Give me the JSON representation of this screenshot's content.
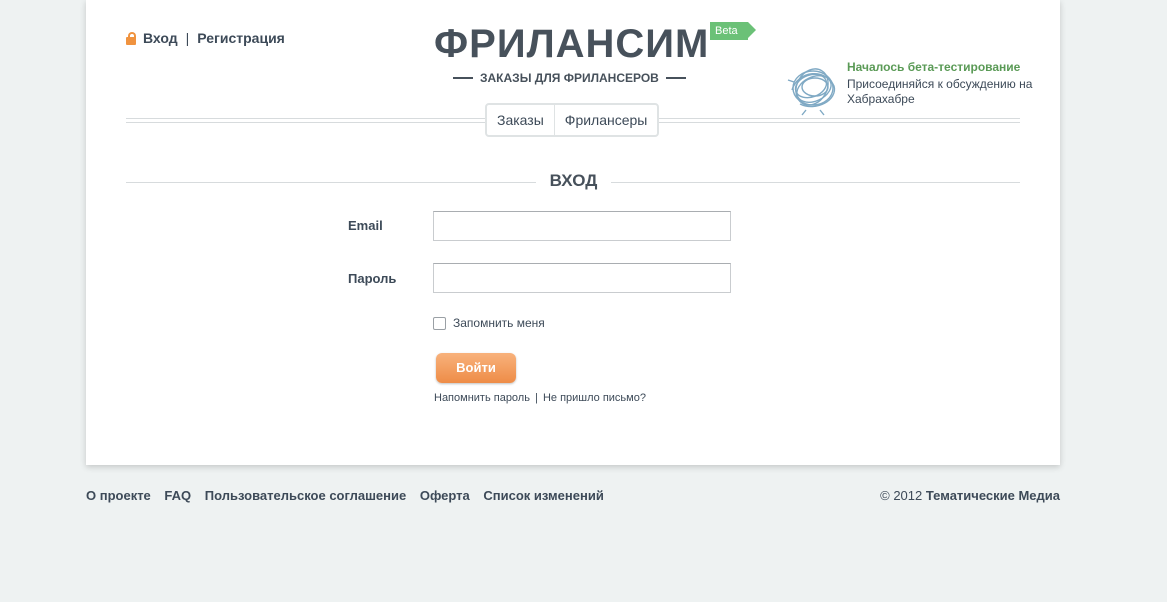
{
  "header": {
    "login_label": "Вход",
    "separator": "|",
    "register_label": "Регистрация",
    "logo_title": "ФРИЛАНСИМ",
    "beta_badge": "Beta",
    "tagline": "ЗАКАЗЫ ДЛЯ ФРИЛАНСЕРОВ",
    "promo_title": "Началось бета-тестирование",
    "promo_text": "Присоединяйся к обсуждению на Хабрахабре"
  },
  "tabs": [
    {
      "label": "Заказы"
    },
    {
      "label": "Фрилансеры"
    }
  ],
  "form": {
    "heading": "ВХОД",
    "email_label": "Email",
    "email_value": "",
    "password_label": "Пароль",
    "password_value": "",
    "remember_label": "Запомнить меня",
    "remember_checked": false,
    "submit_label": "Войти",
    "forgot_link": "Напомнить пароль",
    "links_sep": "|",
    "no_email_link": "Не пришло письмо?"
  },
  "footer": {
    "links": [
      "О проекте",
      "FAQ",
      "Пользовательское соглашение",
      "Оферта",
      "Список изменений"
    ],
    "copyright_prefix": "© 2012",
    "copyright_owner": "Тематические Медиа"
  },
  "colors": {
    "background": "#eef2f2",
    "accent_orange": "#ee8c47",
    "beta_green": "#6bc177",
    "promo_green": "#5a9a56",
    "text_dark": "#3d4a58"
  },
  "icons": {
    "lock": "lock-icon",
    "promo": "habr-tangle-icon",
    "chevron_tag": "beta-flag"
  }
}
